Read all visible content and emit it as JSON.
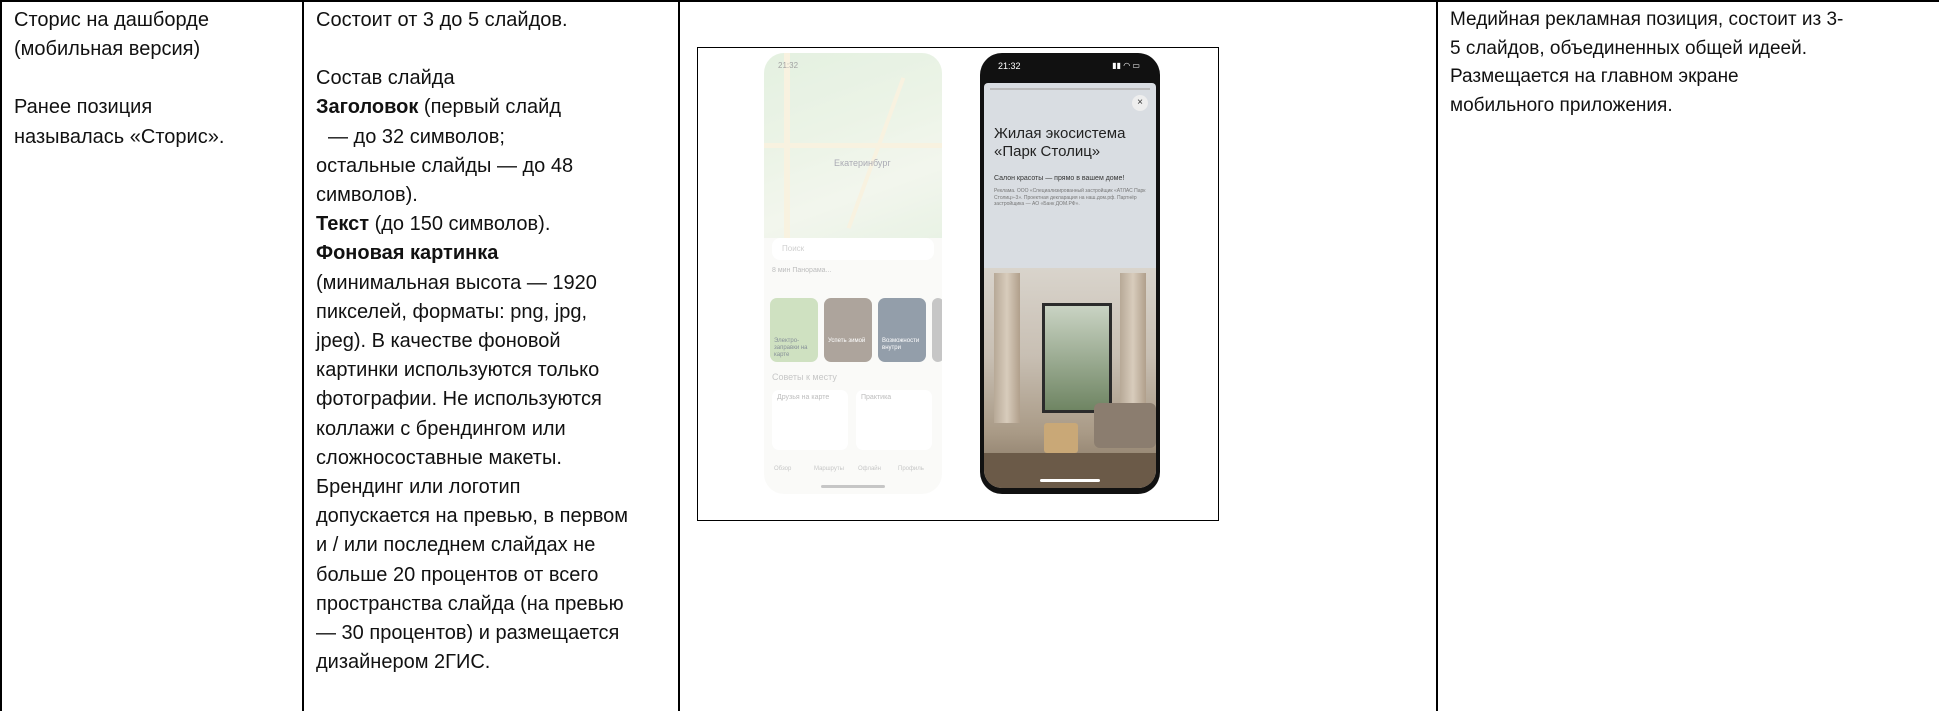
{
  "col1": {
    "line1": "Сторис на дашборде",
    "line2": "(мобильная версия)",
    "line3": "Ранее позиция",
    "line4": "называлась «Сторис»."
  },
  "col2": {
    "intro": "Состоит от 3 до 5 слайдов.",
    "composition": "Состав слайда",
    "title_label": "Заголовок",
    "title_rest": " (первый слайд",
    "title_l2": "— до 32 символов;",
    "title_l3": "остальные слайды — до 48",
    "title_l4": "символов).",
    "text_label": "Текст",
    "text_rest": " (до 150 символов).",
    "bg_label": "Фоновая картинка",
    "lines": [
      "(минимальная высота — 1920",
      "пикселей, форматы: png, jpg,",
      "jpeg). В качестве фоновой",
      "картинки используются только",
      "фотографии. Не используются",
      "коллажи с брендингом или",
      "сложносоставные макеты.",
      "Брендинг или логотип",
      "допускается на превью, в первом",
      "и / или последнем слайдах не",
      "больше 20 процентов от всего",
      "пространства слайда (на превью",
      "— 30 процентов) и размещается",
      "дизайнером 2ГИС."
    ]
  },
  "phone_left": {
    "time": "21:32",
    "city": "Екатеринбург",
    "search": "Поиск",
    "chips": "8 мин   Панорама...   ",
    "tiles": [
      "Электро-заправки на карте",
      "Успеть зимой",
      "Возможности внутри"
    ],
    "advice": "Советы к месту",
    "cards": [
      "Друзья на карте",
      "Практика"
    ],
    "nav": [
      "Обзор",
      "Маршруты",
      "Офлайн",
      "Профиль"
    ]
  },
  "phone_right": {
    "time": "21:32",
    "close": "×",
    "title": "Жилая экосистема «Парк Столиц»",
    "subtitle": "Салон красоты — прямо в вашем доме!",
    "fine": "Реклама. ООО «Специализированный застройщик «АТЛАС Парк Столиц»-3». Проектная декларация на наш.дом.рф. Партнёр застройщика — АО «Банк ДОМ.РФ»."
  },
  "col4": {
    "lines": [
      "Медийная рекламная позиция, состоит из 3-",
      "5 слайдов, объединенных общей идеей.",
      "Размещается на главном экране",
      "мобильного приложения."
    ]
  }
}
